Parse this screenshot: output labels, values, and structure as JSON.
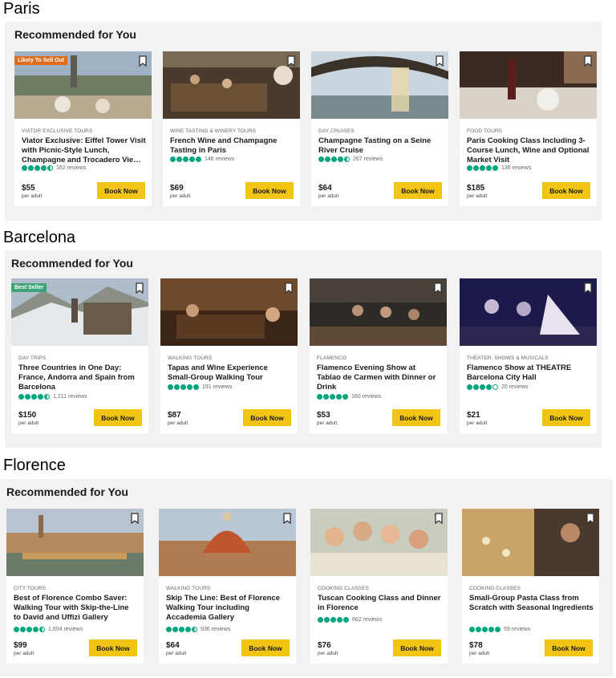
{
  "sections": [
    {
      "city": "Paris",
      "heading": "Recommended for You",
      "cards": [
        {
          "badge": "Likely To Sell Out",
          "badge_color": "#e06c1b",
          "category": "Viator Exclusive Tours",
          "title": "Viator Exclusive: Eiffel Tower Visit with Picnic-Style Lunch, Champagne and Trocadero Vie…",
          "rating": 4.5,
          "reviews": "162 reviews",
          "price": "$55",
          "per": "per adult",
          "cta": "Book Now"
        },
        {
          "badge": "",
          "category": "Wine Tasting & Winery Tours",
          "title": "French Wine and Champagne Tasting in Paris",
          "rating": 5,
          "reviews": "146 reviews",
          "price": "$69",
          "per": "per adult",
          "cta": "Book Now"
        },
        {
          "badge": "",
          "category": "Day Cruises",
          "title": "Champagne Tasting on a Seine River Cruise",
          "rating": 4.5,
          "reviews": "267 reviews",
          "price": "$64",
          "per": "per adult",
          "cta": "Book Now"
        },
        {
          "badge": "",
          "category": "Food Tours",
          "title": "Paris Cooking Class Including 3-Course Lunch, Wine and Optional Market Visit",
          "rating": 5,
          "reviews": "136 reviews",
          "price": "$185",
          "per": "per adult",
          "cta": "Book Now"
        }
      ]
    },
    {
      "city": "Barcelona",
      "heading": "Recommended for You",
      "cards": [
        {
          "badge": "Best Seller",
          "badge_color": "#3fa578",
          "category": "Day Trips",
          "title": "Three Countries in One Day: France, Andorra and Spain from Barcelona",
          "rating": 4.5,
          "reviews": "1,211 reviews",
          "price": "$150",
          "per": "per adult",
          "cta": "Book Now"
        },
        {
          "badge": "",
          "category": "Walking Tours",
          "title": "Tapas and Wine Experience Small-Group Walking Tour",
          "rating": 5,
          "reviews": "191 reviews",
          "price": "$87",
          "per": "per adult",
          "cta": "Book Now"
        },
        {
          "badge": "",
          "category": "Flamenco",
          "title": "Flamenco Evening Show at Tablao de Carmen with Dinner or Drink",
          "rating": 5,
          "reviews": "160 reviews",
          "price": "$53",
          "per": "per adult",
          "cta": "Book Now"
        },
        {
          "badge": "",
          "category": "Theater, Shows & Musicals",
          "title": "Flamenco Show at THEATRE Barcelona City Hall",
          "rating": 4,
          "reviews": "20 reviews",
          "price": "$21",
          "per": "per adult",
          "cta": "Book Now"
        }
      ]
    },
    {
      "city": "Florence",
      "heading": "Recommended for You",
      "cards": [
        {
          "badge": "",
          "category": "City Tours",
          "title": "Best of Florence Combo Saver: Walking Tour with Skip-the-Line to David and Uffizi Gallery",
          "rating": 4.5,
          "reviews": "1,654 reviews",
          "price": "$99",
          "per": "per adult",
          "cta": "Book Now"
        },
        {
          "badge": "",
          "category": "Walking Tours",
          "title": "Skip The Line: Best of Florence Walking Tour including Accademia Gallery",
          "rating": 4.5,
          "reviews": "936 reviews",
          "price": "$64",
          "per": "per adult",
          "cta": "Book Now"
        },
        {
          "badge": "",
          "category": "Cooking Classes",
          "title": "Tuscan Cooking Class and Dinner in Florence",
          "rating": 5,
          "reviews": "662 reviews",
          "price": "$76",
          "per": "per adult",
          "cta": "Book Now"
        },
        {
          "badge": "",
          "category": "Cooking Classes",
          "title": "Small-Group Pasta Class from Scratch with Seasonal Ingredients",
          "rating": 5,
          "reviews": "59 reviews",
          "price": "$78",
          "per": "per adult",
          "cta": "Book Now"
        }
      ]
    }
  ]
}
